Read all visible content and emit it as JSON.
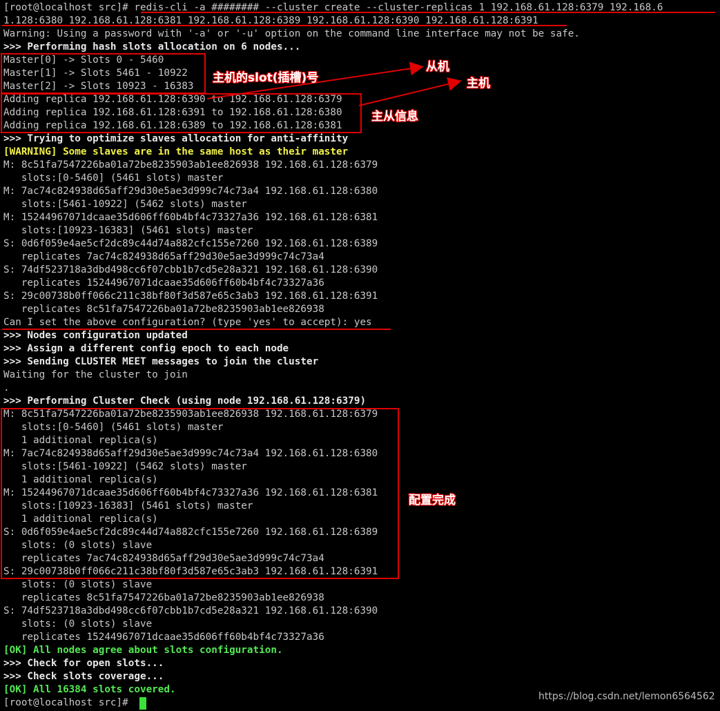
{
  "terminal": {
    "lines": [
      {
        "text": "[root@localhost src]# redis-cli -a ######## --cluster create --cluster-replicas 1 192.168.61.128:6379 192.168.6",
        "style": "plain"
      },
      {
        "text": "1.128:6380 192.168.61.128:6381 192.168.61.128:6389 192.168.61.128:6390 192.168.61.128:6391",
        "style": "plain"
      },
      {
        "text": "Warning: Using a password with '-a' or '-u' option on the command line interface may not be safe.",
        "style": "plain"
      },
      {
        "text": ">>> Performing hash slots allocation on 6 nodes...",
        "style": "bold"
      },
      {
        "text": "Master[0] -> Slots 0 - 5460",
        "style": "plain"
      },
      {
        "text": "Master[1] -> Slots 5461 - 10922",
        "style": "plain"
      },
      {
        "text": "Master[2] -> Slots 10923 - 16383",
        "style": "plain"
      },
      {
        "text": "Adding replica 192.168.61.128:6390 to 192.168.61.128:6379",
        "style": "plain"
      },
      {
        "text": "Adding replica 192.168.61.128:6391 to 192.168.61.128:6380",
        "style": "plain"
      },
      {
        "text": "Adding replica 192.168.61.128:6389 to 192.168.61.128:6381",
        "style": "plain"
      },
      {
        "text": ">>> Trying to optimize slaves allocation for anti-affinity",
        "style": "bold"
      },
      {
        "text": "[WARNING] Some slaves are in the same host as their master",
        "style": "yellow"
      },
      {
        "text": "M: 8c51fa7547226ba01a72be8235903ab1ee826938 192.168.61.128:6379",
        "style": "plain"
      },
      {
        "text": "   slots:[0-5460] (5461 slots) master",
        "style": "plain"
      },
      {
        "text": "M: 7ac74c824938d65aff29d30e5ae3d999c74c73a4 192.168.61.128:6380",
        "style": "plain"
      },
      {
        "text": "   slots:[5461-10922] (5462 slots) master",
        "style": "plain"
      },
      {
        "text": "M: 15244967071dcaae35d606ff60b4bf4c73327a36 192.168.61.128:6381",
        "style": "plain"
      },
      {
        "text": "   slots:[10923-16383] (5461 slots) master",
        "style": "plain"
      },
      {
        "text": "S: 0d6f059e4ae5cf2dc89c44d74a882cfc155e7260 192.168.61.128:6389",
        "style": "plain"
      },
      {
        "text": "   replicates 7ac74c824938d65aff29d30e5ae3d999c74c73a4",
        "style": "plain"
      },
      {
        "text": "S: 74df523718a3dbd498cc6f07cbb1b7cd5e28a321 192.168.61.128:6390",
        "style": "plain"
      },
      {
        "text": "   replicates 15244967071dcaae35d606ff60b4bf4c73327a36",
        "style": "plain"
      },
      {
        "text": "S: 29c00738b0ff066c211c38bf80f3d587e65c3ab3 192.168.61.128:6391",
        "style": "plain"
      },
      {
        "text": "   replicates 8c51fa7547226ba01a72be8235903ab1ee826938",
        "style": "plain"
      },
      {
        "text": "Can I set the above configuration? (type 'yes' to accept): yes",
        "style": "plain"
      },
      {
        "text": ">>> Nodes configuration updated",
        "style": "bold"
      },
      {
        "text": ">>> Assign a different config epoch to each node",
        "style": "bold"
      },
      {
        "text": ">>> Sending CLUSTER MEET messages to join the cluster",
        "style": "bold"
      },
      {
        "text": "Waiting for the cluster to join",
        "style": "plain"
      },
      {
        "text": ".",
        "style": "plain"
      },
      {
        "text": ">>> Performing Cluster Check (using node 192.168.61.128:6379)",
        "style": "bold"
      },
      {
        "text": "M: 8c51fa7547226ba01a72be8235903ab1ee826938 192.168.61.128:6379",
        "style": "plain"
      },
      {
        "text": "   slots:[0-5460] (5461 slots) master",
        "style": "plain"
      },
      {
        "text": "   1 additional replica(s)",
        "style": "plain"
      },
      {
        "text": "M: 7ac74c824938d65aff29d30e5ae3d999c74c73a4 192.168.61.128:6380",
        "style": "plain"
      },
      {
        "text": "   slots:[5461-10922] (5462 slots) master",
        "style": "plain"
      },
      {
        "text": "   1 additional replica(s)",
        "style": "plain"
      },
      {
        "text": "M: 15244967071dcaae35d606ff60b4bf4c73327a36 192.168.61.128:6381",
        "style": "plain"
      },
      {
        "text": "   slots:[10923-16383] (5461 slots) master",
        "style": "plain"
      },
      {
        "text": "   1 additional replica(s)",
        "style": "plain"
      },
      {
        "text": "S: 0d6f059e4ae5cf2dc89c44d74a882cfc155e7260 192.168.61.128:6389",
        "style": "plain"
      },
      {
        "text": "   slots: (0 slots) slave",
        "style": "plain"
      },
      {
        "text": "   replicates 7ac74c824938d65aff29d30e5ae3d999c74c73a4",
        "style": "plain"
      },
      {
        "text": "S: 29c00738b0ff066c211c38bf80f3d587e65c3ab3 192.168.61.128:6391",
        "style": "plain"
      },
      {
        "text": "   slots: (0 slots) slave",
        "style": "plain"
      },
      {
        "text": "   replicates 8c51fa7547226ba01a72be8235903ab1ee826938",
        "style": "plain"
      },
      {
        "text": "S: 74df523718a3dbd498cc6f07cbb1b7cd5e28a321 192.168.61.128:6390",
        "style": "plain"
      },
      {
        "text": "   slots: (0 slots) slave",
        "style": "plain"
      },
      {
        "text": "   replicates 15244967071dcaae35d606ff60b4bf4c73327a36",
        "style": "plain"
      },
      {
        "text": "[OK] All nodes agree about slots configuration.",
        "style": "green"
      },
      {
        "text": ">>> Check for open slots...",
        "style": "bold"
      },
      {
        "text": ">>> Check slots coverage...",
        "style": "bold"
      },
      {
        "text": "[OK] All 16384 slots covered.",
        "style": "green"
      },
      {
        "text": "[root@localhost src]# ",
        "style": "plain"
      }
    ]
  },
  "annotations": {
    "slot_label": "主机的slot(插槽)号",
    "slave_label": "从机",
    "master_label": "主机",
    "master_slave_info": "主从信息",
    "config_done": "配置完成"
  },
  "watermark": "https://blog.csdn.net/lemon6564562",
  "colors": {
    "background": "#000000",
    "text": "#c8c8c8",
    "highlight_red": "#e00000",
    "warning_yellow": "#f2f24a",
    "ok_green": "#54e854"
  }
}
